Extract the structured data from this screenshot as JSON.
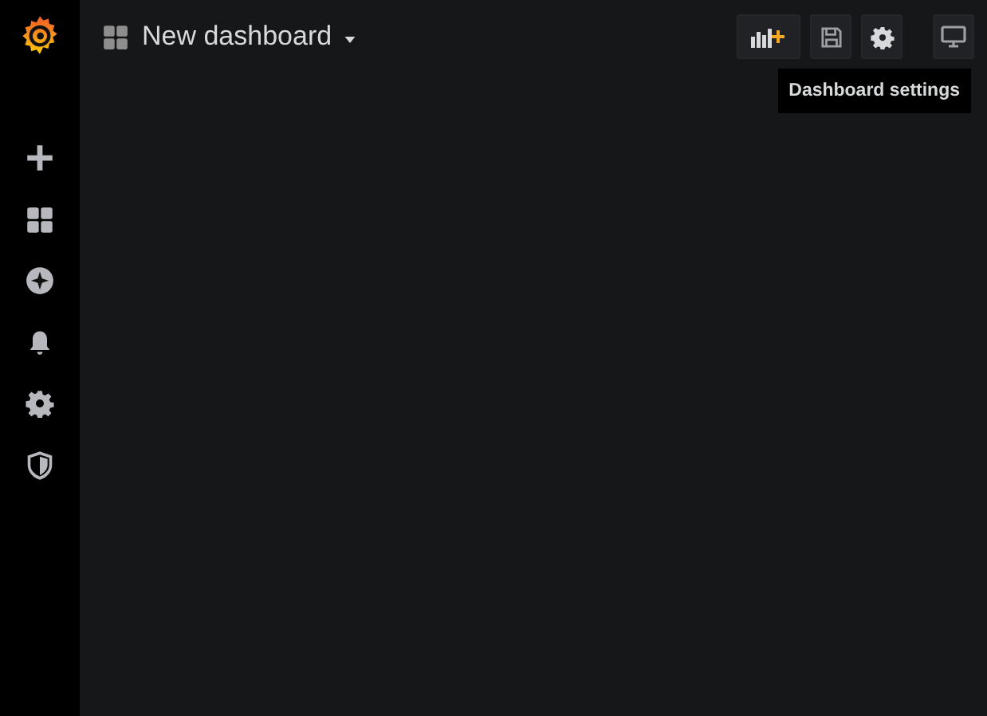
{
  "sidebar": {
    "items": [
      {
        "kind": "create"
      },
      {
        "kind": "dashboards"
      },
      {
        "kind": "explore"
      },
      {
        "kind": "alerts"
      },
      {
        "kind": "config"
      },
      {
        "kind": "shield"
      }
    ]
  },
  "header": {
    "title": "New dashboard"
  },
  "toolbar": [
    {
      "kind": "add-panel"
    },
    {
      "kind": "save"
    },
    {
      "kind": "settings"
    },
    {
      "kind": "gap"
    },
    {
      "kind": "tv"
    }
  ],
  "tooltip": {
    "text": "Dashboard settings"
  }
}
